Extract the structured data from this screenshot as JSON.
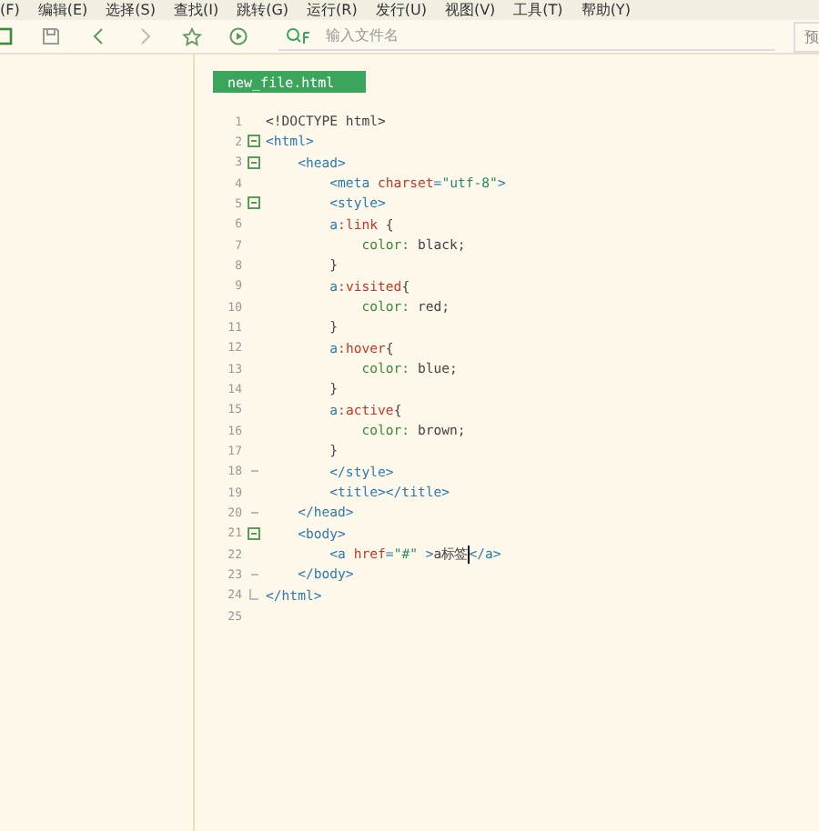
{
  "menu_bar": [
    "(F)",
    "编辑(E)",
    "选择(S)",
    "查找(I)",
    "跳转(G)",
    "运行(R)",
    "发行(U)",
    "视图(V)",
    "工具(T)",
    "帮助(Y)"
  ],
  "toolbar": {
    "search": {
      "placeholder": "输入文件名"
    },
    "preview_label": "预"
  },
  "editor": {
    "tab": {
      "label": "new_file.html",
      "selected": true
    },
    "lines": [
      {
        "number": "1",
        "tokens": [
          {
            "kind": "text",
            "text": "<!DOCTYPE html>"
          }
        ]
      },
      {
        "number": "2",
        "expanded": true,
        "tokens": [
          {
            "kind": "tag",
            "text": "<html>"
          }
        ]
      },
      {
        "number": "3",
        "expanded": true,
        "tokens": [
          {
            "kind": "tag",
            "text": "    <head>"
          }
        ]
      },
      {
        "number": "4",
        "tokens": [
          {
            "kind": "tag",
            "text": "        <meta "
          },
          {
            "kind": "attr",
            "text": "charset"
          },
          {
            "kind": "tag",
            "text": "="
          },
          {
            "kind": "value",
            "text": "\"utf-8\""
          },
          {
            "kind": "tag",
            "text": ">"
          }
        ]
      },
      {
        "number": "5",
        "expanded": true,
        "tokens": [
          {
            "kind": "tag",
            "text": "        <style>"
          }
        ]
      },
      {
        "number": "6",
        "tokens": [
          {
            "kind": "selector",
            "text": "        a"
          },
          {
            "kind": "pseudo",
            "text": ":link"
          },
          {
            "kind": "text",
            "text": " {"
          }
        ]
      },
      {
        "number": "7",
        "tokens": [
          {
            "kind": "property",
            "text": "            color:"
          },
          {
            "kind": "text",
            "text": " black;"
          }
        ]
      },
      {
        "number": "8",
        "tokens": [
          {
            "kind": "text",
            "text": "        }"
          }
        ]
      },
      {
        "number": "9",
        "tokens": [
          {
            "kind": "selector",
            "text": "        a"
          },
          {
            "kind": "pseudo",
            "text": ":visited"
          },
          {
            "kind": "text",
            "text": "{"
          }
        ]
      },
      {
        "number": "10",
        "tokens": [
          {
            "kind": "property",
            "text": "            color:"
          },
          {
            "kind": "text",
            "text": " red;"
          }
        ]
      },
      {
        "number": "11",
        "tokens": [
          {
            "kind": "text",
            "text": "        }"
          }
        ]
      },
      {
        "number": "12",
        "tokens": [
          {
            "kind": "selector",
            "text": "        a"
          },
          {
            "kind": "pseudo",
            "text": ":hover"
          },
          {
            "kind": "text",
            "text": "{"
          }
        ]
      },
      {
        "number": "13",
        "tokens": [
          {
            "kind": "property",
            "text": "            color:"
          },
          {
            "kind": "text",
            "text": " blue;"
          }
        ]
      },
      {
        "number": "14",
        "tokens": [
          {
            "kind": "text",
            "text": "        }"
          }
        ]
      },
      {
        "number": "15",
        "tokens": [
          {
            "kind": "selector",
            "text": "        a"
          },
          {
            "kind": "pseudo",
            "text": ":active"
          },
          {
            "kind": "text",
            "text": "{"
          }
        ]
      },
      {
        "number": "16",
        "tokens": [
          {
            "kind": "property",
            "text": "            color:"
          },
          {
            "kind": "text",
            "text": " brown;"
          }
        ]
      },
      {
        "number": "17",
        "tokens": [
          {
            "kind": "text",
            "text": "        }"
          }
        ]
      },
      {
        "number": "18",
        "block_end": true,
        "tokens": [
          {
            "kind": "tag",
            "text": "        </style>"
          }
        ]
      },
      {
        "number": "19",
        "tokens": [
          {
            "kind": "tag",
            "text": "        <title></title>"
          }
        ]
      },
      {
        "number": "20",
        "block_end": true,
        "tokens": [
          {
            "kind": "tag",
            "text": "    </head>"
          }
        ]
      },
      {
        "number": "21",
        "expanded": true,
        "tokens": [
          {
            "kind": "tag",
            "text": "    <body>"
          }
        ]
      },
      {
        "number": "22",
        "tokens": [
          {
            "kind": "tag",
            "text": "        <a "
          },
          {
            "kind": "attr",
            "text": "href"
          },
          {
            "kind": "tag",
            "text": "="
          },
          {
            "kind": "value",
            "text": "\"#\""
          },
          {
            "kind": "tag",
            "text": " >"
          },
          {
            "kind": "text",
            "text": "a标签",
            "caret": true
          },
          {
            "kind": "tag",
            "text": "</a>"
          }
        ]
      },
      {
        "number": "23",
        "block_end": true,
        "tokens": [
          {
            "kind": "tag",
            "text": "    </body>"
          }
        ]
      },
      {
        "number": "24",
        "block_end": true,
        "tokens": [
          {
            "kind": "tag",
            "text": "</html>"
          }
        ]
      },
      {
        "number": "25"
      }
    ]
  }
}
